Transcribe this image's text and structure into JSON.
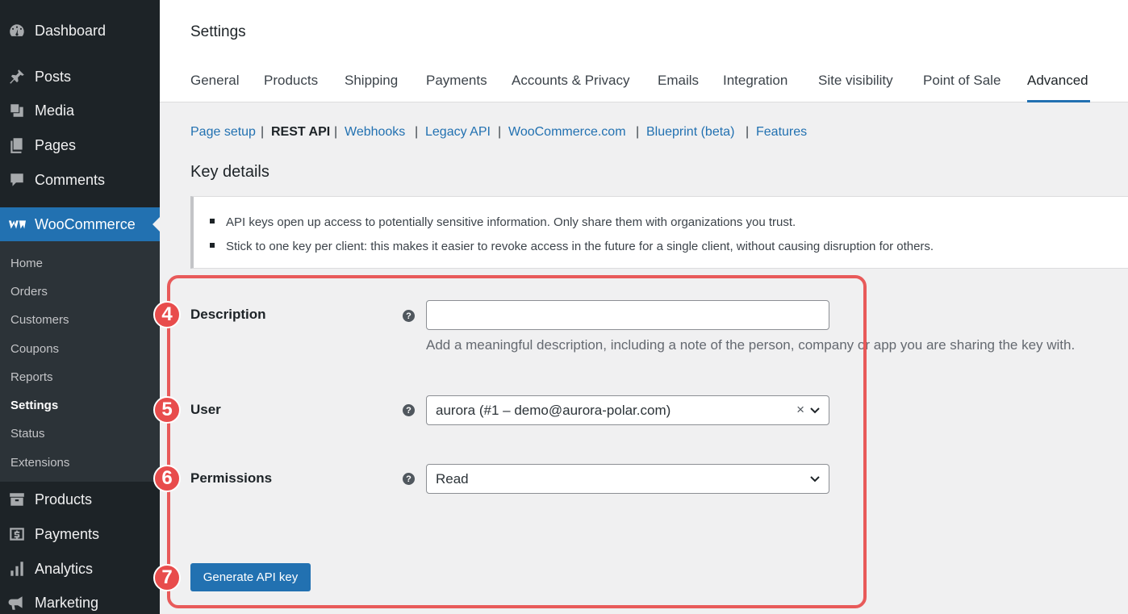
{
  "sidebar": {
    "items": [
      {
        "label": "Dashboard",
        "icon": "dashboard-icon"
      },
      {
        "label": "Posts",
        "icon": "pin-icon"
      },
      {
        "label": "Media",
        "icon": "media-icon"
      },
      {
        "label": "Pages",
        "icon": "pages-icon"
      },
      {
        "label": "Comments",
        "icon": "comment-icon"
      },
      {
        "label": "WooCommerce",
        "icon": "woocommerce-icon"
      },
      {
        "label": "Products",
        "icon": "archive-icon"
      },
      {
        "label": "Payments",
        "icon": "dollar-icon"
      },
      {
        "label": "Analytics",
        "icon": "chart-icon"
      },
      {
        "label": "Marketing",
        "icon": "megaphone-icon"
      }
    ],
    "submenu": [
      "Home",
      "Orders",
      "Customers",
      "Coupons",
      "Reports",
      "Settings",
      "Status",
      "Extensions"
    ],
    "current_submenu": "Settings",
    "accent_color": "#2271b1"
  },
  "header": {
    "title": "Settings",
    "tabs": [
      "General",
      "Products",
      "Shipping",
      "Payments",
      "Accounts & Privacy",
      "Emails",
      "Integration",
      "Site visibility",
      "Point of Sale",
      "Advanced"
    ],
    "active_tab": "Advanced"
  },
  "subnav": {
    "items": [
      "Page setup",
      "REST API",
      "Webhooks",
      "Legacy API",
      "WooCommerce.com",
      "Blueprint (beta)",
      "Features"
    ],
    "current": "REST API",
    "separator": "|"
  },
  "section_title": "Key details",
  "notice": [
    "API keys open up access to potentially sensitive information. Only share them with organizations you trust.",
    "Stick to one key per client: this makes it easier to revoke access in the future for a single client, without causing disruption for others."
  ],
  "form": {
    "description": {
      "label": "Description",
      "value": "",
      "hint": "Add a meaningful description, including a note of the person, company or app you are sharing the key with.",
      "step": "4"
    },
    "user": {
      "label": "User",
      "value": "aurora (#1 – demo@aurora-polar.com)",
      "clear": "×",
      "step": "5"
    },
    "permissions": {
      "label": "Permissions",
      "value": "Read",
      "step": "6"
    },
    "help": "?",
    "submit": {
      "label": "Generate API key",
      "step": "7"
    }
  },
  "annotation_color": "#e85a5a"
}
